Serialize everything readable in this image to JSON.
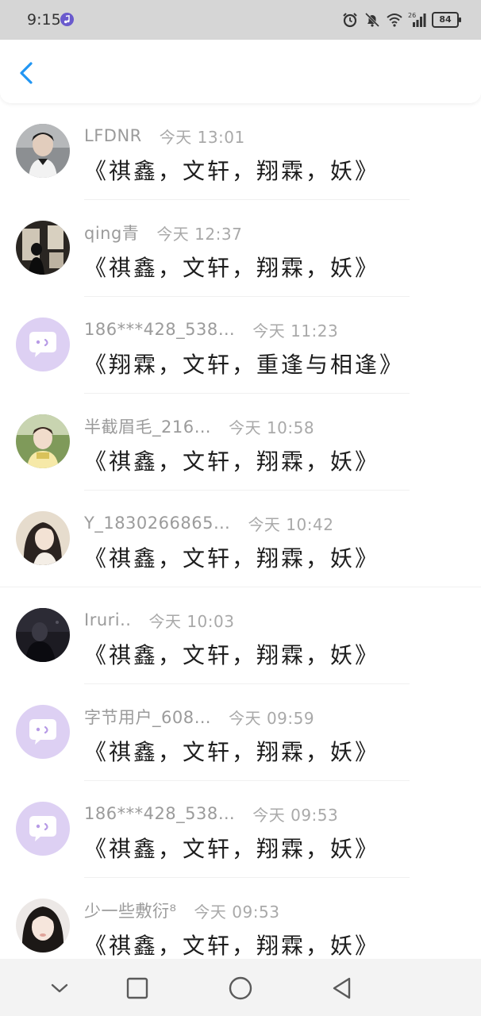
{
  "status_bar": {
    "time": "9:15",
    "network": "26",
    "battery": "84"
  },
  "header": {
    "back_icon": "chevron-left-icon",
    "accent_color": "#2196f3"
  },
  "comments": [
    {
      "username": "LFDNR",
      "time": "今天 13:01",
      "text": "《祺鑫，文轩，翔霖，妖》",
      "avatar": "photo-boy-white-shirt"
    },
    {
      "username": "qing青",
      "time": "今天 12:37",
      "text": "《祺鑫，文轩，翔霖，妖》",
      "avatar": "photo-dark-room"
    },
    {
      "username": "186***428_538…",
      "time": "今天 11:23",
      "text": "《翔霖，文轩，重逢与相逢》",
      "avatar": "default-chat-bubble"
    },
    {
      "username": "半截眉毛_216…",
      "time": "今天 10:58",
      "text": "《祺鑫，文轩，翔霖，妖》",
      "avatar": "photo-boy-outdoor"
    },
    {
      "username": "Y_1830266865…",
      "time": "今天 10:42",
      "text": "《祺鑫，文轩，翔霖，妖》",
      "avatar": "photo-girl-dark-hair"
    },
    {
      "username": "Iruri..",
      "time": "今天 10:03",
      "text": "《祺鑫，文轩，翔霖，妖》",
      "avatar": "photo-dark-night"
    },
    {
      "username": "字节用户_608…",
      "time": "今天 09:59",
      "text": "《祺鑫，文轩，翔霖，妖》",
      "avatar": "default-chat-bubble"
    },
    {
      "username": "186***428_538…",
      "time": "今天 09:53",
      "text": "《祺鑫，文轩，翔霖，妖》",
      "avatar": "default-chat-bubble"
    },
    {
      "username": "少一些敷衍⁸",
      "time": "今天 09:53",
      "text": "《祺鑫，文轩，翔霖，妖》",
      "avatar": "photo-girl-selfie"
    }
  ],
  "nav_bar": {
    "icons": [
      "chevron-down-icon",
      "square-recent-icon",
      "circle-home-icon",
      "triangle-back-icon"
    ]
  }
}
